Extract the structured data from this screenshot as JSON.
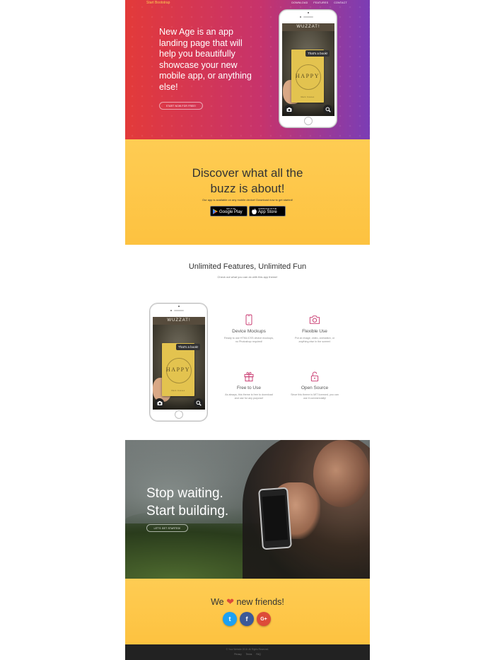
{
  "nav": {
    "brand": "Start Bootstrap",
    "links": [
      "Download",
      "Features",
      "Contact"
    ]
  },
  "hero": {
    "heading": "New Age is an app landing page that will help you beautifully showcase your new mobile app, or anything else!",
    "button": "Start Now for Free!"
  },
  "phone_app": {
    "app_name": "WUZZAT!",
    "bubble": "That's a book!",
    "book_title": "HAPPY",
    "book_author": "Mark Coates",
    "icons": [
      "camera-icon",
      "search-icon"
    ]
  },
  "download": {
    "heading": "Discover what all the buzz is about!",
    "text": "Our app is available on any mobile device! Download now to get started!",
    "google_small": "GET IT ON",
    "google_big": "Google Play",
    "apple_small": "Download on the",
    "apple_big": "App Store"
  },
  "features": {
    "title": "Unlimited Features, Unlimited Fun",
    "subtitle": "Check out what you can do with this app theme!",
    "items": [
      {
        "title": "Device Mockups",
        "text": "Ready to use HTML/CSS device mockups, no Photoshop required!",
        "icon": "phone-icon"
      },
      {
        "title": "Flexible Use",
        "text": "Put an image, video, animation, or anything else in the screen!",
        "icon": "camera-icon"
      },
      {
        "title": "Free to Use",
        "text": "As always, this theme is free to download and use for any purpose!",
        "icon": "gift-icon"
      },
      {
        "title": "Open Source",
        "text": "Since this theme is MIT licensed, you can use it commercially!",
        "icon": "lock-open-icon"
      }
    ]
  },
  "cta": {
    "line1": "Stop waiting.",
    "line2": "Start building.",
    "button": "Let's Get Started!"
  },
  "contact": {
    "pre": "We",
    "post": "new friends!",
    "socials": [
      {
        "name": "twitter",
        "glyph": "t",
        "color": "#1da1f2"
      },
      {
        "name": "facebook",
        "glyph": "f",
        "color": "#3b5998"
      },
      {
        "name": "google-plus",
        "glyph": "G+",
        "color": "#dd4b39"
      }
    ]
  },
  "footer": {
    "copyright": "© Your Website 2018. All Rights Reserved.",
    "links": [
      "Privacy",
      "Terms",
      "FAQ"
    ]
  },
  "colors": {
    "accent": "#fdcc52",
    "hero_start": "#e33a39",
    "hero_end": "#7b3db5",
    "feature_icon": "#c7336b",
    "footer_bg": "#222222"
  }
}
